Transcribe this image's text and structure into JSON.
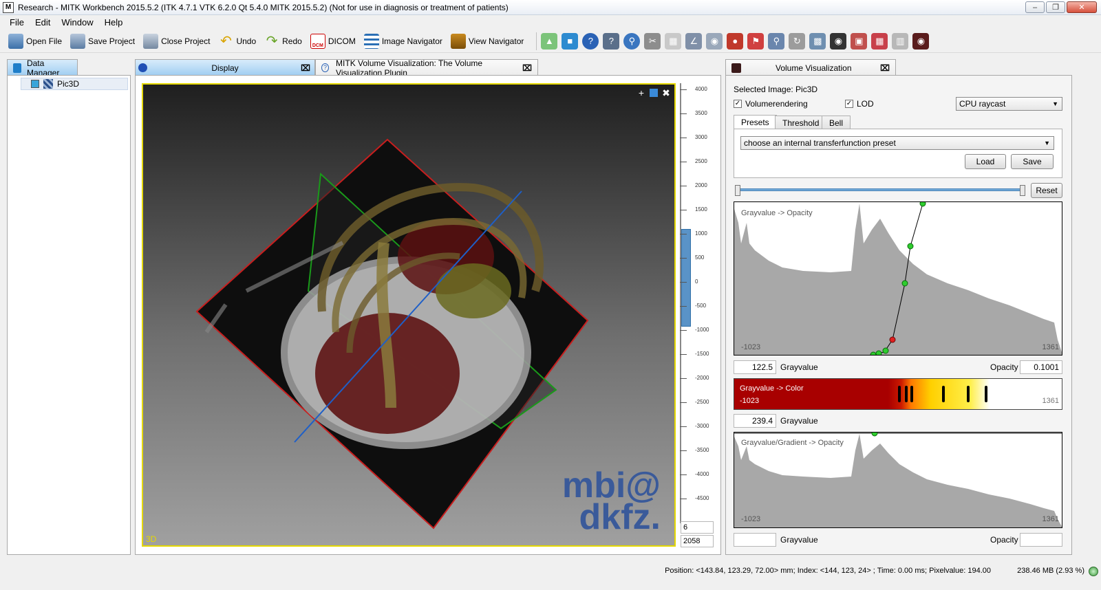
{
  "window": {
    "title": "Research - MITK Workbench 2015.5.2 (ITK 4.7.1  VTK 6.2.0 Qt 5.4.0 MITK 2015.5.2) (Not for use in diagnosis or treatment of patients)",
    "app_icon": "M"
  },
  "menu": [
    "File",
    "Edit",
    "Window",
    "Help"
  ],
  "toolbar": {
    "open_file": "Open File",
    "save_project": "Save Project",
    "close_project": "Close Project",
    "undo": "Undo",
    "redo": "Redo",
    "dicom": "DICOM",
    "image_navigator": "Image Navigator",
    "view_navigator": "View Navigator"
  },
  "data_manager": {
    "tab": "Data Manager",
    "items": [
      "Pic3D"
    ]
  },
  "editor_tabs": {
    "display": "Display",
    "plugin": "MITK Volume Visualization: The Volume Visualization Plugin"
  },
  "view3d": {
    "label": "3D",
    "logo_line1": "mbi@",
    "logo_line2": "dkfz."
  },
  "level_window": {
    "ticks": [
      "4000",
      "3500",
      "3000",
      "2500",
      "2000",
      "1500",
      "1000",
      "500",
      "0",
      "-500",
      "-1000",
      "-1500",
      "-2000",
      "-2500",
      "-3000",
      "-3500",
      "-4000",
      "-4500"
    ],
    "level": "6",
    "window": "2058"
  },
  "volume_visualization": {
    "tab": "Volume Visualization",
    "selected_image": "Selected Image: Pic3D",
    "volumerendering_label": "Volumerendering",
    "lod_label": "LOD",
    "render_mode": "CPU raycast",
    "subtabs": [
      "Presets",
      "Threshold",
      "Bell"
    ],
    "preset_combo": "choose an internal transferfunction preset",
    "load": "Load",
    "save": "Save",
    "reset": "Reset",
    "opacity_chart": {
      "label": "Grayvalue -> Opacity",
      "min": "-1023",
      "max": "1361",
      "grayvalue": "122.5",
      "grayvalue_label": "Grayvalue",
      "opacity_label": "Opacity",
      "opacity": "0.1001"
    },
    "color_chart": {
      "label": "Grayvalue -> Color",
      "min": "-1023",
      "max": "1361",
      "grayvalue": "239.4",
      "grayvalue_label": "Grayvalue"
    },
    "gradient_chart": {
      "label": "Grayvalue/Gradient -> Opacity",
      "min": "-1023",
      "max": "1361",
      "grayvalue_label": "Grayvalue",
      "opacity_label": "Opacity"
    }
  },
  "status": {
    "position": "Position: <143.84, 123.29, 72.00> mm; Index: <144, 123, 24> ; Time: 0.00 ms; Pixelvalue: 194.00",
    "memory": "238.46 MB (2.93 %)"
  },
  "colors": {
    "view_border": "#e5d800",
    "plane_red": "#c81e1e",
    "plane_green": "#1a9a1a",
    "plane_blue": "#1e5fc8",
    "colormap_red": "#a80000"
  }
}
